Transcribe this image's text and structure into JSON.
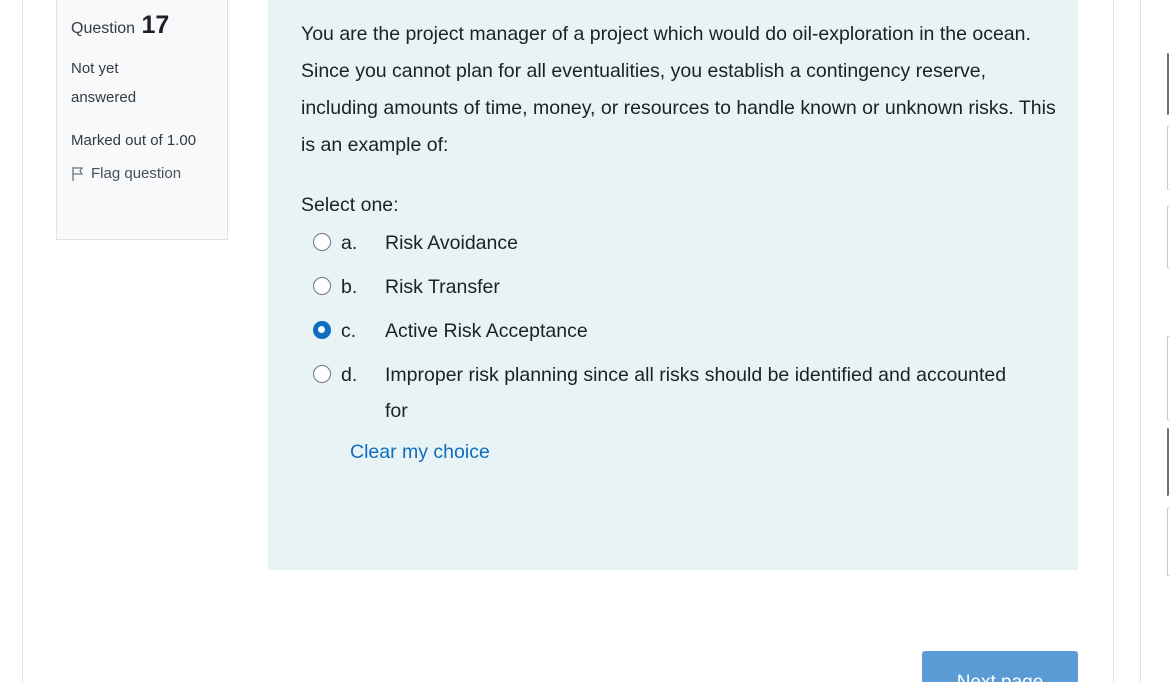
{
  "question_info": {
    "label": "Question",
    "number": "17",
    "state": "Not yet answered",
    "grade": "Marked out of 1.00",
    "flag_label": "Flag question"
  },
  "question": {
    "text": "You are the project manager of a project which would do oil-exploration in the ocean. Since you cannot plan for all eventualities, you establish a contingency reserve, including amounts of time, money, or resources to handle known or unknown risks. This is an example of:",
    "prompt": "Select one:",
    "answers": [
      {
        "letter": "a.",
        "text": "Risk Avoidance",
        "selected": false
      },
      {
        "letter": "b.",
        "text": "Risk Transfer",
        "selected": false
      },
      {
        "letter": "c.",
        "text": "Active Risk Acceptance",
        "selected": true
      },
      {
        "letter": "d.",
        "text": "Improper risk planning since all risks should be identified and accounted for",
        "selected": false
      }
    ],
    "clear_label": "Clear my choice"
  },
  "navigation": {
    "next_label": "Next page"
  },
  "colors": {
    "content_bg": "#e7f3f5",
    "info_bg": "#f8f9fa",
    "link": "#0f6cbf",
    "next_button": "#5b9bd5"
  }
}
